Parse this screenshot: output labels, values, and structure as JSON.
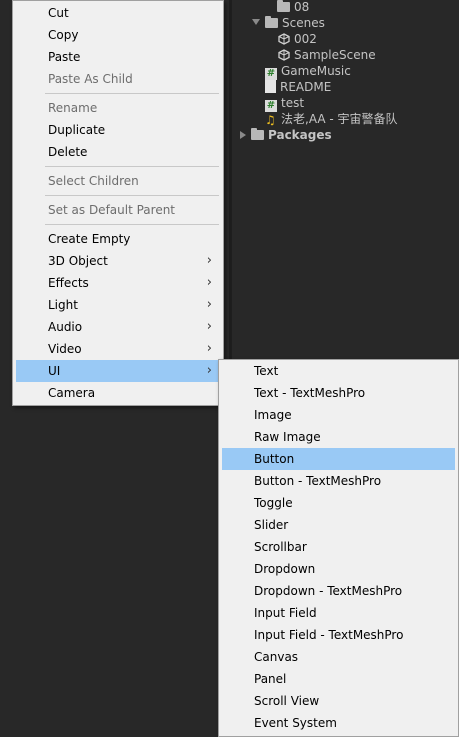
{
  "project_tree": {
    "items": [
      {
        "label": "08",
        "kind": "folder"
      },
      {
        "label": "Scenes",
        "kind": "folder-open"
      },
      {
        "label": "002",
        "kind": "scene"
      },
      {
        "label": "SampleScene",
        "kind": "scene"
      },
      {
        "label": "GameMusic",
        "kind": "script"
      },
      {
        "label": "README",
        "kind": "document"
      },
      {
        "label": "test",
        "kind": "script"
      },
      {
        "label": "法老,AA - 宇宙警备队",
        "kind": "audio"
      },
      {
        "label": "Packages",
        "kind": "folder"
      }
    ]
  },
  "context_menu": {
    "items": [
      {
        "label": "Cut",
        "disabled": false
      },
      {
        "label": "Copy",
        "disabled": false
      },
      {
        "label": "Paste",
        "disabled": false
      },
      {
        "label": "Paste As Child",
        "disabled": true
      },
      {
        "label": "Rename",
        "disabled": true
      },
      {
        "label": "Duplicate",
        "disabled": false
      },
      {
        "label": "Delete",
        "disabled": false
      },
      {
        "label": "Select Children",
        "disabled": true
      },
      {
        "label": "Set as Default Parent",
        "disabled": true
      },
      {
        "label": "Create Empty",
        "disabled": false
      },
      {
        "label": "3D Object",
        "disabled": false,
        "submenu": true
      },
      {
        "label": "Effects",
        "disabled": false,
        "submenu": true
      },
      {
        "label": "Light",
        "disabled": false,
        "submenu": true
      },
      {
        "label": "Audio",
        "disabled": false,
        "submenu": true
      },
      {
        "label": "Video",
        "disabled": false,
        "submenu": true
      },
      {
        "label": "UI",
        "disabled": false,
        "submenu": true,
        "highlighted": true
      },
      {
        "label": "Camera",
        "disabled": false
      }
    ],
    "chevron": "›"
  },
  "ui_submenu": {
    "items": [
      {
        "label": "Text"
      },
      {
        "label": "Text - TextMeshPro"
      },
      {
        "label": "Image"
      },
      {
        "label": "Raw Image"
      },
      {
        "label": "Button",
        "highlighted": true
      },
      {
        "label": "Button - TextMeshPro"
      },
      {
        "label": "Toggle"
      },
      {
        "label": "Slider"
      },
      {
        "label": "Scrollbar"
      },
      {
        "label": "Dropdown"
      },
      {
        "label": "Dropdown - TextMeshPro"
      },
      {
        "label": "Input Field"
      },
      {
        "label": "Input Field - TextMeshPro"
      },
      {
        "label": "Canvas"
      },
      {
        "label": "Panel"
      },
      {
        "label": "Scroll View"
      },
      {
        "label": "Event System"
      }
    ]
  },
  "colors": {
    "highlight": "#99c9f5",
    "menu_bg": "#f0f0f0",
    "editor_bg": "#282828"
  }
}
